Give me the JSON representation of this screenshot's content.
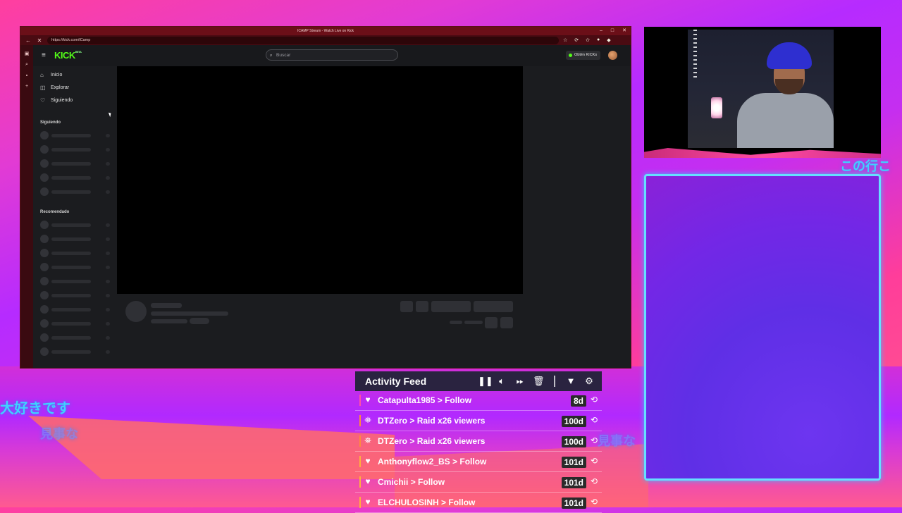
{
  "browser": {
    "window_title": "ICAMP Stream - Watch Live on Kick",
    "url": "https://kick.com/iCamp",
    "window_controls": [
      "–",
      "□",
      "✕"
    ]
  },
  "kick": {
    "logo": "KICK",
    "logo_badge": "BETA",
    "search_placeholder": "Buscar",
    "kicks_button": "Obtén KICKs",
    "nav": [
      {
        "label": "Inicio",
        "icon": "home-icon"
      },
      {
        "label": "Explorar",
        "icon": "compass-icon"
      },
      {
        "label": "Siguiendo",
        "icon": "heart-icon"
      }
    ],
    "following_section": "Siguiendo",
    "recommended_section": "Recomendado"
  },
  "overlay_text": {
    "jp_right_top": "この行こ",
    "jp_left_1": "大好きです",
    "jp_left_2": "見事な",
    "jp_right_mid": "見事な"
  },
  "activity_feed": {
    "title": "Activity Feed",
    "controls": [
      "pause-icon",
      "volume-icon",
      "skip-icon",
      "trash-icon",
      "filter-icon",
      "gear-icon"
    ],
    "items": [
      {
        "name": "Catapulta1985",
        "action": "Follow",
        "age": "8d",
        "type": "follow",
        "color": "#ff4fa8"
      },
      {
        "name": "DTZero",
        "action": "Raid x26 viewers",
        "age": "100d",
        "type": "raid",
        "color": "#ff8a3d"
      },
      {
        "name": "DTZero",
        "action": "Raid x26 viewers",
        "age": "100d",
        "type": "raid",
        "color": "#ff8a3d"
      },
      {
        "name": "Anthonyflow2_BS",
        "action": "Follow",
        "age": "101d",
        "type": "follow",
        "color": "#ffb03d"
      },
      {
        "name": "Cmichii",
        "action": "Follow",
        "age": "101d",
        "type": "follow",
        "color": "#ffb03d"
      },
      {
        "name": "ELCHULOSINH",
        "action": "Follow",
        "age": "101d",
        "type": "follow",
        "color": "#ffb03d"
      }
    ],
    "arrow": ">"
  }
}
